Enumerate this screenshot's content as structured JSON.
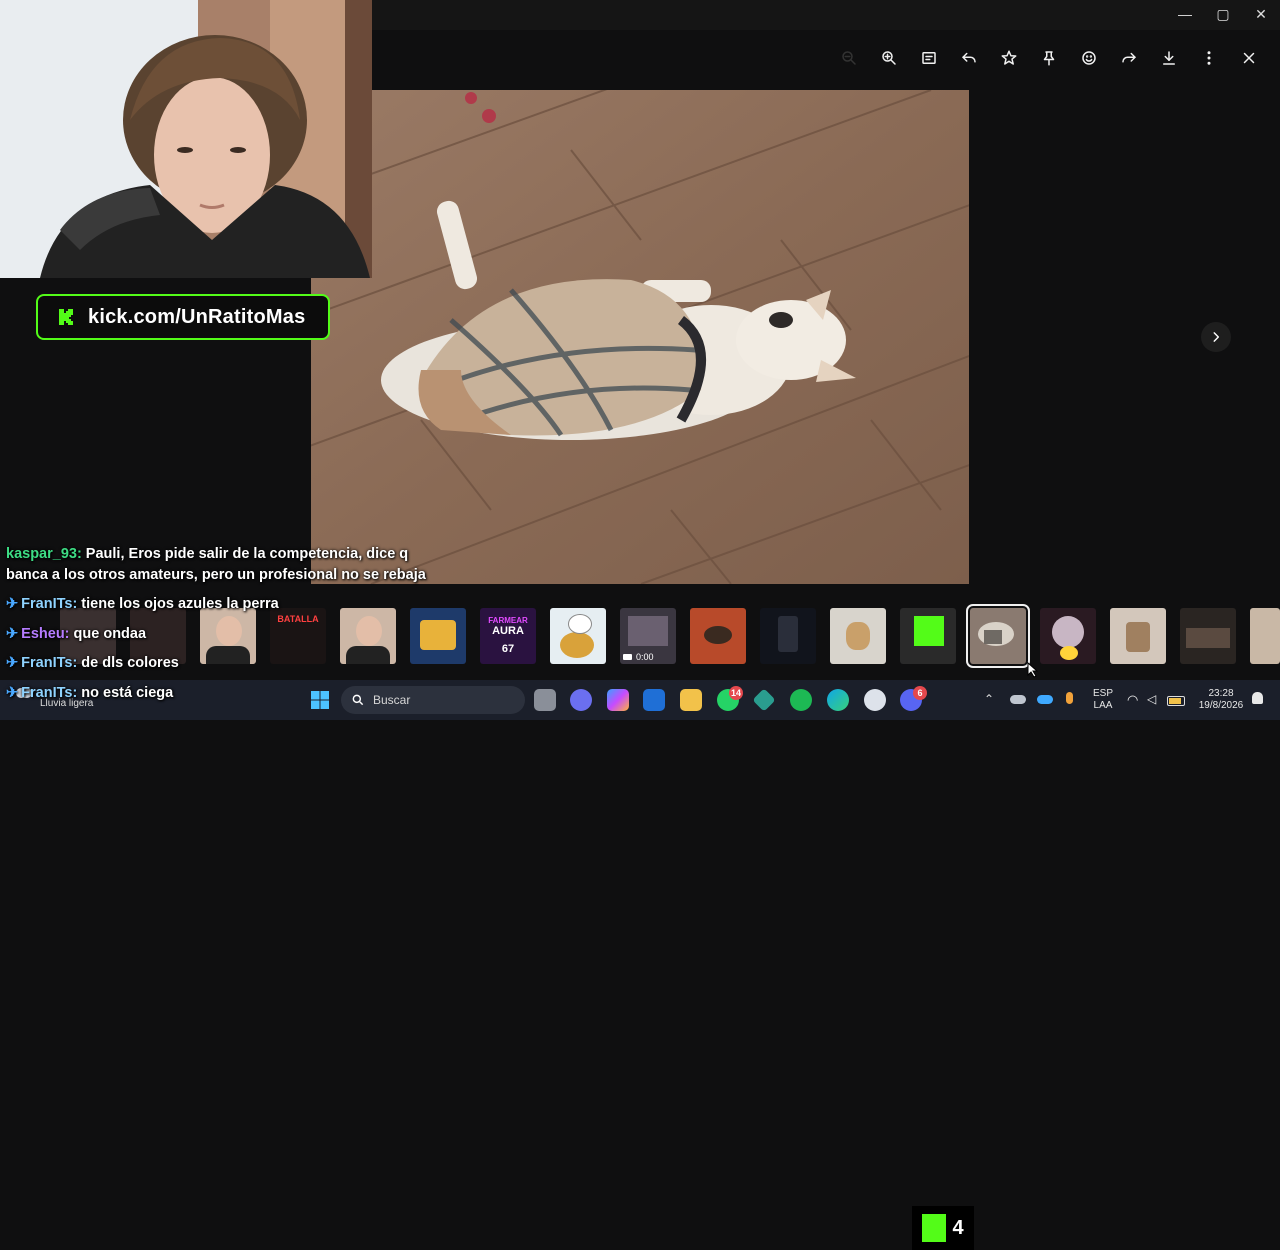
{
  "window": {
    "minimize_glyph": "—",
    "maximize_glyph": "▢",
    "close_glyph": "✕"
  },
  "toolbar": {
    "icons": [
      "zoom-out-icon",
      "zoom-in-icon",
      "caption-icon",
      "reply-icon",
      "star-icon",
      "pin-icon",
      "emoji-icon",
      "forward-icon",
      "download-icon",
      "more-icon",
      "close-icon"
    ]
  },
  "overlay": {
    "kick_url": "kick.com/UnRatitoMas",
    "brand_color": "#53fc18"
  },
  "chat": {
    "messages": [
      {
        "user": "kaspar_93:",
        "text": " Pauli, Eros pide salir de la competencia, dice q",
        "color": "#3ddc84",
        "pinned": false
      },
      {
        "user": "",
        "text": "banca a los otros amateurs, pero un profesional no se rebaja",
        "color": "#ffffff",
        "pinned": false
      },
      {
        "user": "FranITs:",
        "text": " tiene los ojos azules la perra",
        "color": "#8fd3ff",
        "pinned": true
      },
      {
        "user": "Esheu:",
        "text": " que ondaa",
        "color": "#b57cff",
        "pinned": true
      },
      {
        "user": "FranITs:",
        "text": " de dls colores",
        "color": "#8fd3ff",
        "pinned": true
      },
      {
        "user": "FranITs:",
        "text": " no está ciega",
        "color": "#8fd3ff",
        "pinned": true
      }
    ]
  },
  "thumbs": {
    "video_duration": "0:00",
    "kick_count": "4",
    "flyer_text_1": "FARMEAR",
    "flyer_text_2": "AURA",
    "flyer_text_3": "67",
    "battle_text": "BATALLA"
  },
  "taskbar": {
    "search_placeholder": "Buscar",
    "weather": "Lluvia ligera",
    "lang_top": "ESP",
    "lang_bottom": "LAA",
    "time": "23:28",
    "date": "19/8/2026",
    "whatsapp_badge": "14",
    "discord_badge": "6"
  }
}
